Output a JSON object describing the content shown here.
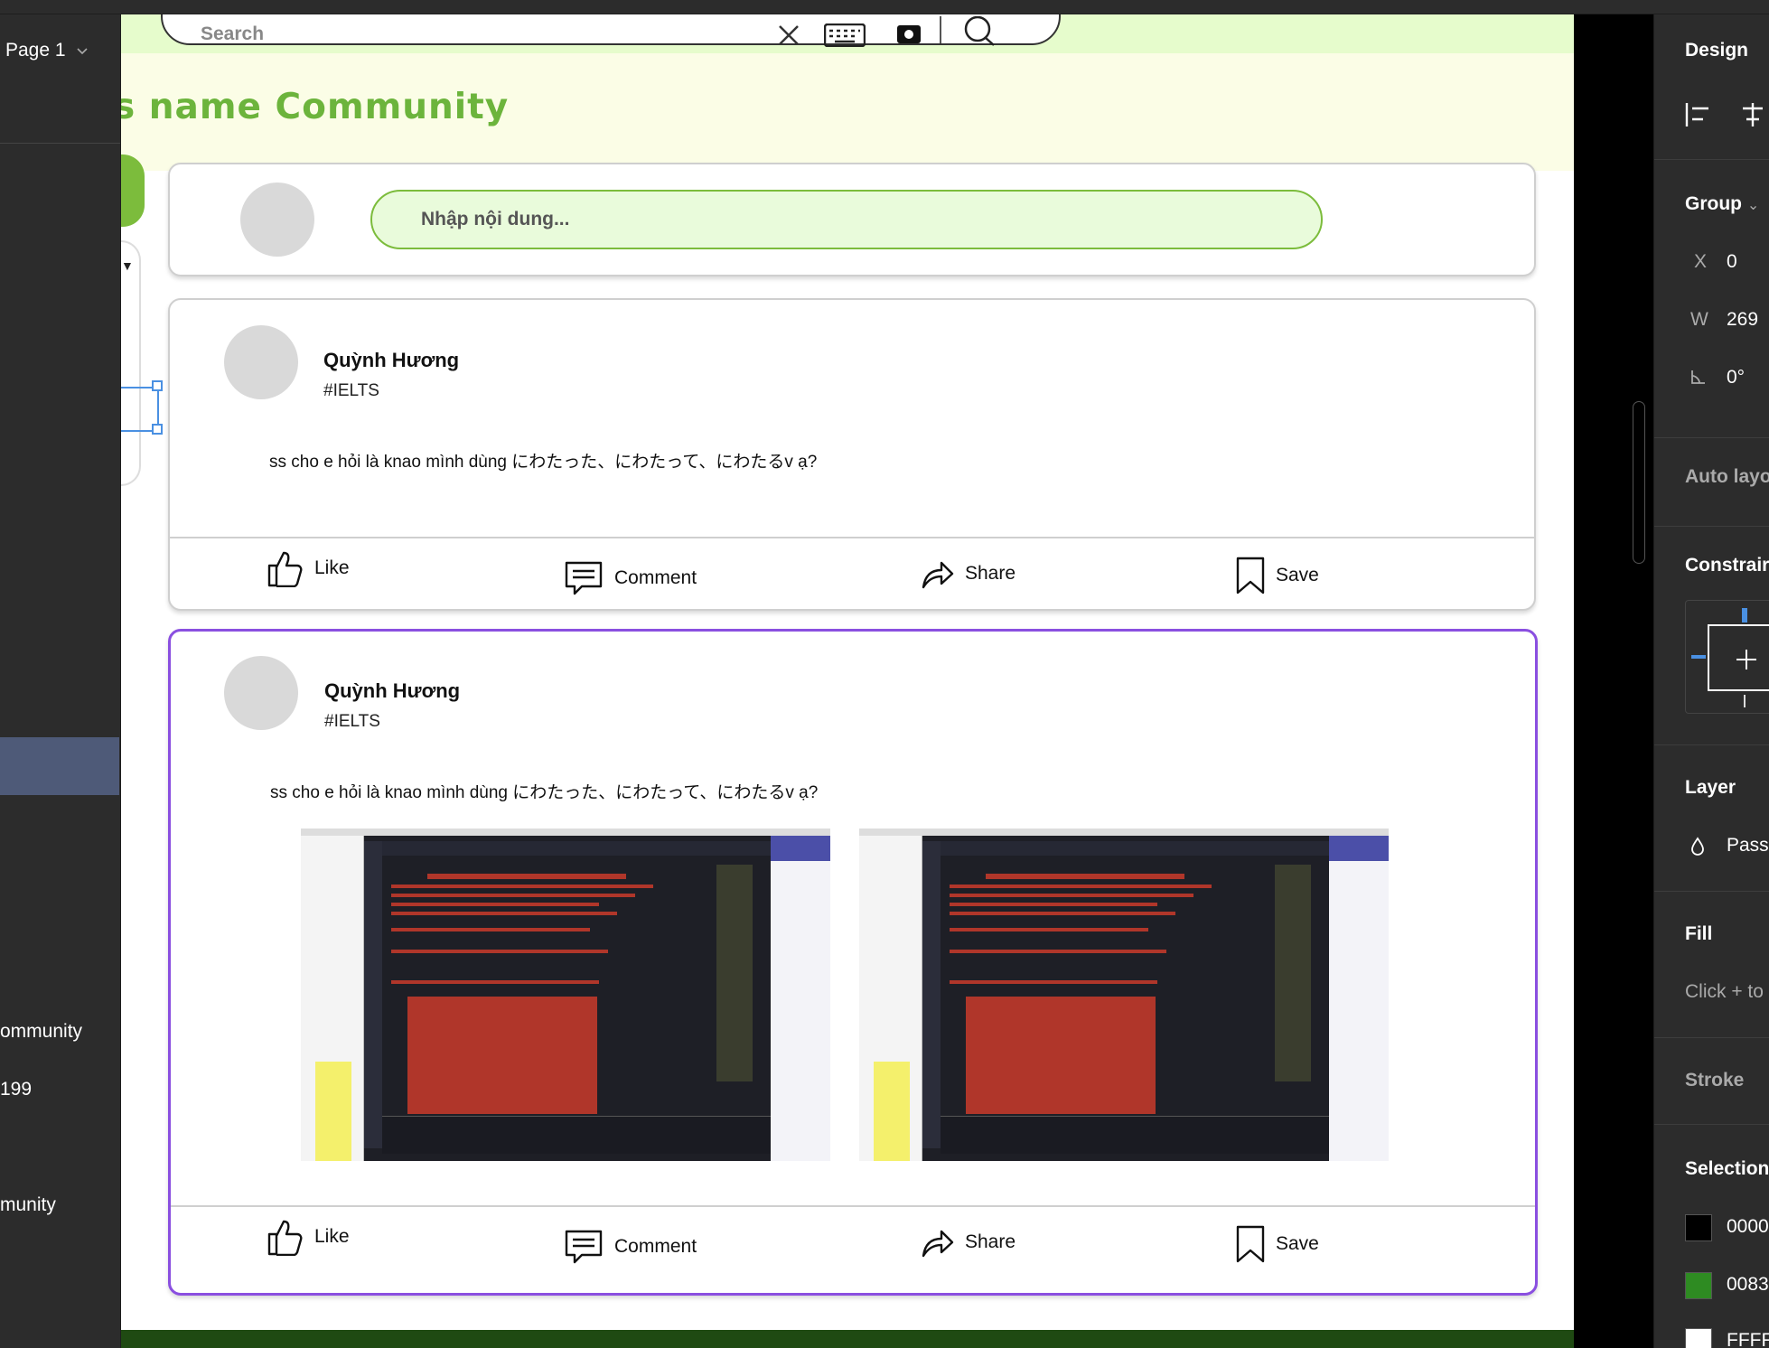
{
  "left_panel": {
    "page_label": "Page 1",
    "items": [
      "ommunity",
      "199",
      "munity"
    ]
  },
  "canvas": {
    "search_placeholder": "Search",
    "site_title": "s name Community",
    "composer": {
      "placeholder": "Nhập nội dung..."
    },
    "posts": [
      {
        "user": "Quỳnh Hương",
        "tag": "#IELTS",
        "text": "ss cho e hỏi là knao mình dùng にわたった、にわたって、にわたるv ạ?"
      },
      {
        "user": "Quỳnh Hương",
        "tag": "#IELTS",
        "text": "ss cho e hỏi là knao mình dùng にわたった、にわたって、にわたるv ạ?"
      }
    ],
    "actions": {
      "like": "Like",
      "comment": "Comment",
      "share": "Share",
      "save": "Save"
    }
  },
  "design_panel": {
    "title": "Design",
    "group_label": "Group",
    "x_label": "X",
    "x_value": "0",
    "w_label": "W",
    "w_value": "269",
    "rotation_value": "0°",
    "auto_layout": "Auto layo",
    "constraints": "Constrair",
    "layer": "Layer",
    "layer_mode": "Pass",
    "fill": "Fill",
    "fill_hint": "Click + to",
    "stroke": "Stroke",
    "selection_colors": "Selection",
    "colors": [
      {
        "label": "0000",
        "hex": "#000000"
      },
      {
        "label": "0083",
        "hex": "#2e8b22"
      },
      {
        "label": "FFFF",
        "hex": "#ffffff"
      }
    ]
  }
}
